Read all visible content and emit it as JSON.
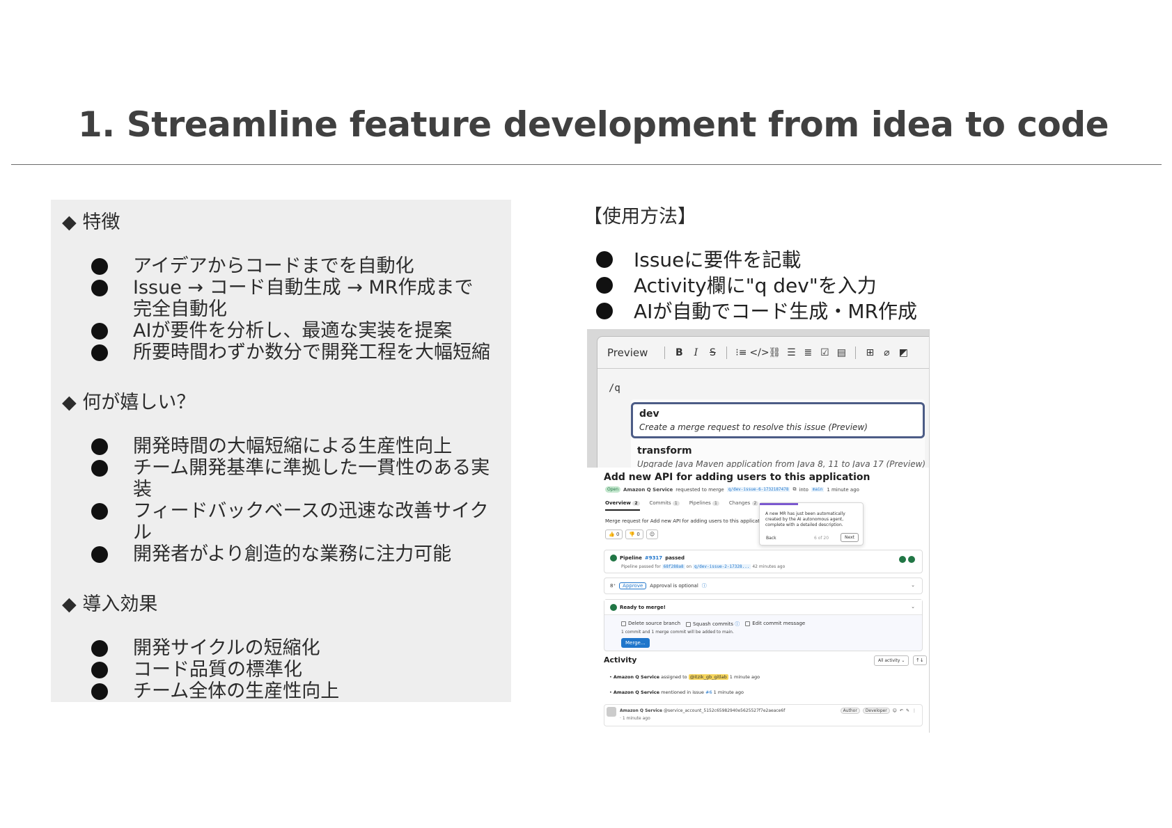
{
  "slide": {
    "title": "1.  Streamline feature development from idea to code"
  },
  "left_panel": {
    "sections": [
      {
        "heading": "◆ 特徴",
        "items": [
          "アイデアからコードまでを自動化",
          "Issue → コード自動生成 → MR作成まで完全自動化",
          "AIが要件を分析し、最適な実装を提案",
          "所要時間わずか数分で開発工程を大幅短縮"
        ]
      },
      {
        "heading": "◆ 何が嬉しい？",
        "items": [
          "開発時間の大幅短縮による生産性向上",
          "チーム開発基準に準拠した一貫性のある実装",
          "フィードバックベースの迅速な改善サイクル",
          "開発者がより創造的な業務に注力可能"
        ]
      },
      {
        "heading": "◆ 導入効果",
        "items": [
          "開発サイクルの短縮化",
          "コード品質の標準化",
          "チーム全体の生産性向上"
        ]
      }
    ]
  },
  "usage": {
    "heading": "【使用方法】",
    "items": [
      "Issueに要件を記載",
      "Activity欄に\"q dev\"を入力",
      "AIが自動でコード生成・MR作成"
    ]
  },
  "screenshot": {
    "editor": {
      "preview_label": "Preview",
      "toolbar_icons": [
        "bold-icon",
        "italic-icon",
        "strikethrough-icon",
        "quote-icon",
        "code-icon",
        "link-icon",
        "bullet-list-icon",
        "numbered-list-icon",
        "task-list-icon",
        "collapsible-icon",
        "table-icon",
        "attach-icon",
        "more-icon"
      ],
      "command_text": "/q",
      "suggestions": [
        {
          "name": "dev",
          "desc": "Create a merge request to resolve this issue (Preview)"
        },
        {
          "name": "transform",
          "desc": "Upgrade Java Maven application from Java 8, 11 to Java 17 (Preview)"
        }
      ]
    },
    "mr": {
      "title": "Add new API for adding users to this application",
      "status": "Open",
      "author": "Amazon Q Service",
      "requested_text": "requested to merge",
      "source_branch": "q/dev-issue-6-1732187478",
      "into_text": "into",
      "target_branch": "main",
      "time": "1 minute ago",
      "tabs": [
        {
          "label": "Overview",
          "count": "2"
        },
        {
          "label": "Commits",
          "count": "1"
        },
        {
          "label": "Pipelines",
          "count": "1"
        },
        {
          "label": "Changes",
          "count": "2"
        }
      ],
      "description": "Merge request for Add new API for adding users to this application",
      "reactions": [
        "👍 0",
        "👎 0",
        "☺"
      ],
      "popover": {
        "text": "A new MR has just been automatically created by the AI autonomous agent, complete with a detailed description.",
        "back": "Back",
        "count": "6 of 20",
        "next": "Next"
      },
      "pipeline": {
        "prefix": "Pipeline",
        "id": "#9317",
        "status": "passed",
        "sub_prefix": "Pipeline passed for",
        "commit": "68f288a8",
        "on_text": "on",
        "branch": "q/dev-issue-2-17328...",
        "time": "42 minutes ago"
      },
      "approval": {
        "button": "Approve",
        "text": "Approval is optional"
      },
      "merge": {
        "title": "Ready to merge!",
        "options": [
          "Delete source branch",
          "Squash commits",
          "Edit commit message"
        ],
        "note": "1 commit and 1 merge commit will be added to main.",
        "button": "Merge..."
      },
      "activity": {
        "title": "Activity",
        "filter": "All activity ⌄",
        "sort": "↑↓",
        "items": [
          {
            "actor": "Amazon Q Service",
            "text": "assigned to",
            "target": "@itzik_gb_gitlab",
            "time": "1 minute ago"
          },
          {
            "actor": "Amazon Q Service",
            "text": "mentioned in issue",
            "target": "#6",
            "time": "1 minute ago"
          }
        ],
        "comment": {
          "author": "Amazon Q Service",
          "handle": "@service_account_5152c65982940e5625527f7e2aeace6f",
          "time": "· 1 minute ago",
          "roles": [
            "Author",
            "Developer"
          ]
        }
      }
    }
  }
}
